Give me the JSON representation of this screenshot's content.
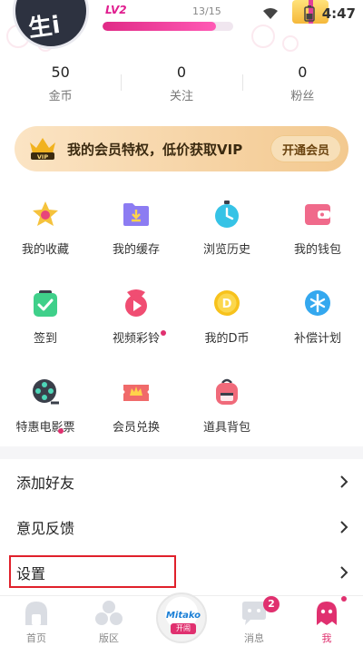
{
  "status_bar": {
    "time": "4:47"
  },
  "profile": {
    "avatar_text": "生i"
  },
  "level": {
    "label": "LV2",
    "xp_text": "13/15",
    "progress": 0.87
  },
  "stats": [
    {
      "value": "50",
      "label": "金币"
    },
    {
      "value": "0",
      "label": "关注"
    },
    {
      "value": "0",
      "label": "粉丝"
    }
  ],
  "vip": {
    "crown_text": "VIP",
    "text": "我的会员特权，低价获取VIP",
    "button": "开通会员"
  },
  "grid": [
    {
      "label": "我的收藏",
      "icon": "star-icon"
    },
    {
      "label": "我的缓存",
      "icon": "download-folder-icon"
    },
    {
      "label": "浏览历史",
      "icon": "clock-icon"
    },
    {
      "label": "我的钱包",
      "icon": "wallet-icon"
    },
    {
      "label": "签到",
      "icon": "checkin-icon"
    },
    {
      "label": "视频彩铃",
      "icon": "video-ringtone-icon"
    },
    {
      "label": "我的D币",
      "icon": "dcoin-icon"
    },
    {
      "label": "补偿计划",
      "icon": "compensation-icon"
    },
    {
      "label": "特惠电影票",
      "icon": "film-reel-icon"
    },
    {
      "label": "会员兑换",
      "icon": "member-exchange-icon"
    },
    {
      "label": "道具背包",
      "icon": "backpack-icon"
    }
  ],
  "menu": [
    {
      "label": "添加好友"
    },
    {
      "label": "意见反馈"
    },
    {
      "label": "设置"
    }
  ],
  "bottom_nav": {
    "items": [
      {
        "label": "首页"
      },
      {
        "label": "版区"
      },
      {
        "label": "消息"
      },
      {
        "label": "我"
      }
    ],
    "center_logo_text": "Mitako",
    "center_logo_sub": "开闹",
    "message_badge": "2"
  },
  "colors": {
    "accent": "#e0306f",
    "vip_gold": "#f6d3a4",
    "highlight": "#e0202b"
  }
}
